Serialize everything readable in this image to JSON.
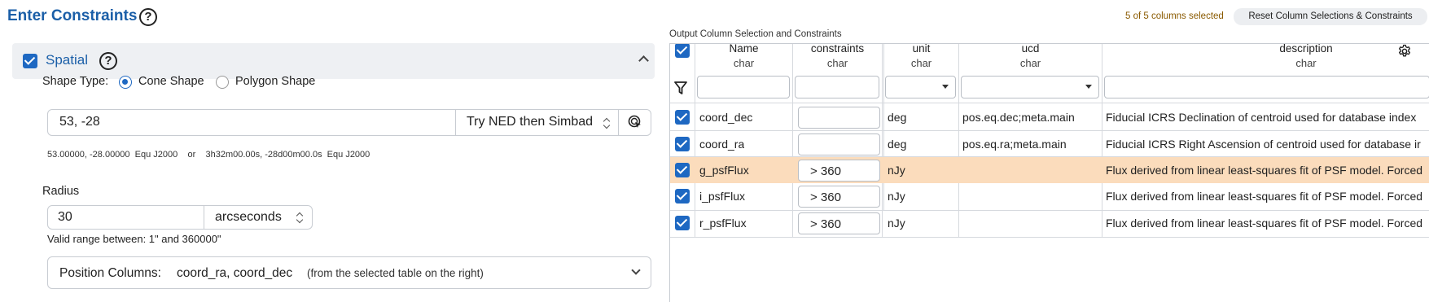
{
  "header": {
    "title": "Enter Constraints"
  },
  "spatial": {
    "label": "Spatial",
    "shape_type_label": "Shape Type:",
    "shape_options": [
      "Cone Shape",
      "Polygon Shape"
    ],
    "selected_shape": "Cone Shape",
    "position_value": "53, -28",
    "resolver": "Try NED then Simbad",
    "coord_readout": "53.00000, -28.00000  Equ J2000    or    3h32m00.00s, -28d00m00.0s  Equ J2000",
    "radius_label": "Radius",
    "radius_value": "30",
    "radius_unit": "arcseconds",
    "valid_range": "Valid range between: 1\" and 360000\"",
    "position_columns_label": "Position Columns:",
    "position_columns_value": "coord_ra, coord_dec",
    "position_columns_hint": "(from the selected table on the right)"
  },
  "output": {
    "label": "Output Column Selection and Constraints",
    "selected_count": "5 of 5 columns selected",
    "reset_label": "Reset Column Selections & Constraints",
    "columns": [
      {
        "name": "Name",
        "type": "char"
      },
      {
        "name": "constraints",
        "type": "char"
      },
      {
        "name": "unit",
        "type": "char"
      },
      {
        "name": "ucd",
        "type": "char"
      },
      {
        "name": "description",
        "type": "char"
      }
    ],
    "rows": [
      {
        "name": "coord_dec",
        "constraint": "",
        "unit": "deg",
        "ucd": "pos.eq.dec;meta.main",
        "description": "Fiducial ICRS Declination of centroid used for database index",
        "highlight": false
      },
      {
        "name": "coord_ra",
        "constraint": "",
        "unit": "deg",
        "ucd": "pos.eq.ra;meta.main",
        "description": "Fiducial ICRS Right Ascension of centroid used for database ir",
        "highlight": false
      },
      {
        "name": "g_psfFlux",
        "constraint": "> 360",
        "unit": "nJy",
        "ucd": "",
        "description": "Flux derived from linear least-squares fit of PSF model. Forced",
        "highlight": true
      },
      {
        "name": "i_psfFlux",
        "constraint": "> 360",
        "unit": "nJy",
        "ucd": "",
        "description": "Flux derived from linear least-squares fit of PSF model. Forced",
        "highlight": false
      },
      {
        "name": "r_psfFlux",
        "constraint": "> 360",
        "unit": "nJy",
        "ucd": "",
        "description": "Flux derived from linear least-squares fit of PSF model. Forced",
        "highlight": false
      }
    ]
  },
  "colors": {
    "accent": "#1e68c2",
    "title": "#1b5fa8",
    "row_highlight": "#fbdcbc"
  }
}
